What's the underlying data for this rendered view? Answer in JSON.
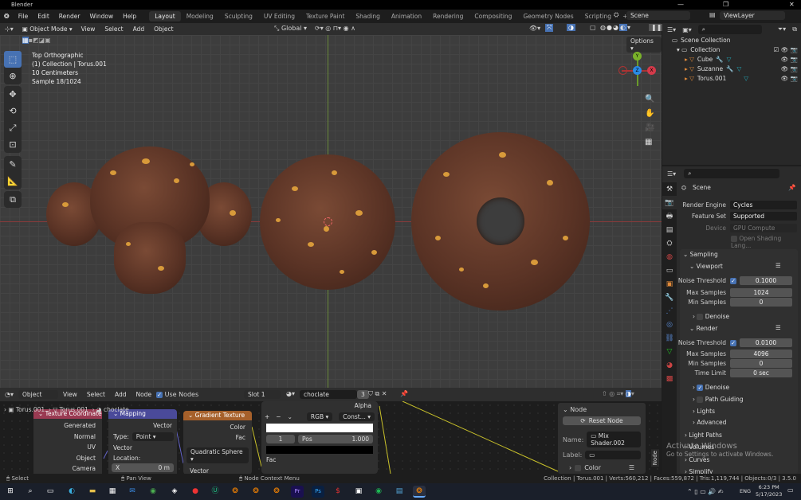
{
  "window": {
    "title": "Blender"
  },
  "menu": [
    "File",
    "Edit",
    "Render",
    "Window",
    "Help"
  ],
  "workspaces": [
    "Layout",
    "Modeling",
    "Sculpting",
    "UV Editing",
    "Texture Paint",
    "Shading",
    "Animation",
    "Rendering",
    "Compositing",
    "Geometry Nodes",
    "Scripting"
  ],
  "active_workspace": "Layout",
  "scene": "Scene",
  "view_layer": "ViewLayer",
  "viewport": {
    "mode": "Object Mode",
    "menus": [
      "View",
      "Select",
      "Add",
      "Object"
    ],
    "orientation": "Global",
    "options": "Options",
    "overlay": [
      "Top Orthographic",
      "(1) Collection | Torus.001",
      "10 Centimeters",
      "Sample 18/1024"
    ],
    "gizmo": {
      "x": "X",
      "y": "Y",
      "z": "Z"
    }
  },
  "outliner": {
    "root": "Scene Collection",
    "collection": "Collection",
    "items": [
      "Cube",
      "Suzanne",
      "Torus.001"
    ]
  },
  "properties": {
    "header": "Scene",
    "render_engine_label": "Render Engine",
    "render_engine": "Cycles",
    "feature_set_label": "Feature Set",
    "feature_set": "Supported",
    "device_label": "Device",
    "device": "GPU Compute",
    "osl": "Open Shading Lang...",
    "sampling": "Sampling",
    "viewport": "Viewport",
    "noise_threshold_label": "Noise Threshold",
    "vp_noise": "0.1000",
    "max_samples_label": "Max Samples",
    "vp_max": "1024",
    "min_samples_label": "Min Samples",
    "vp_min": "0",
    "denoise": "Denoise",
    "render": "Render",
    "r_noise": "0.0100",
    "r_max": "4096",
    "r_min": "0",
    "time_limit_label": "Time Limit",
    "time_limit": "0 sec",
    "path_guiding": "Path Guiding",
    "lights": "Lights",
    "advanced": "Advanced",
    "light_paths": "Light Paths",
    "volumes": "Volumes",
    "curves": "Curves",
    "simplify": "Simplify"
  },
  "node_editor": {
    "type": "Object",
    "menus": [
      "View",
      "Select",
      "Add",
      "Node"
    ],
    "use_nodes": "Use Nodes",
    "slot": "Slot 1",
    "material": "choclate",
    "users": "3",
    "breadcrumb": [
      "Torus.001",
      "Torus.001",
      "choclate"
    ],
    "nodes": {
      "texcoord": {
        "title": "Texture Coordinate",
        "outputs": [
          "Generated",
          "Normal",
          "UV",
          "Object",
          "Camera"
        ]
      },
      "mapping": {
        "title": "Mapping",
        "output": "Vector",
        "type_label": "Type:",
        "type": "Point",
        "input": "Vector",
        "location": "Location:",
        "x_label": "X",
        "x": "0 m"
      },
      "gradient": {
        "title": "Gradient Texture",
        "outputs": [
          "Color",
          "Fac"
        ],
        "mode": "Quadratic Sphere",
        "input": "Vector"
      },
      "ramp": {
        "alpha": "Alpha",
        "color_mode": "RGB",
        "interp": "Const...",
        "index": "1",
        "pos_label": "Pos",
        "pos": "1.000",
        "fac": "Fac"
      }
    },
    "sidebar": {
      "panel": "Node",
      "reset": "Reset Node",
      "name_label": "Name:",
      "name": "Mix Shader.002",
      "label_label": "Label:",
      "color": "Color",
      "tab": "Node"
    }
  },
  "status": {
    "select": "Select",
    "pan": "Pan View",
    "context": "Node Context Menu",
    "stats": "Collection | Torus.001 | Verts:560,212 | Faces:559,872 | Tris:1,119,744 | Objects:0/3 | 3.5.0"
  },
  "watermark": {
    "line1": "Activate Windows",
    "line2": "Go to Settings to activate Windows."
  },
  "taskbar": {
    "lang": "ENG",
    "time": "6:23 PM",
    "date": "5/17/2023"
  }
}
